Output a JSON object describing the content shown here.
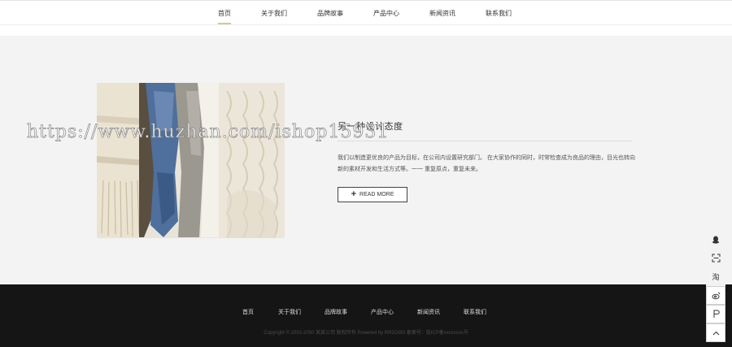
{
  "nav": {
    "items": [
      {
        "label": "首页",
        "active": true
      },
      {
        "label": "关于我们"
      },
      {
        "label": "品牌故事"
      },
      {
        "label": "产品中心"
      },
      {
        "label": "新闻资讯"
      },
      {
        "label": "联系我们"
      }
    ],
    "accent_color": "#d8c79b"
  },
  "feature": {
    "title": "另一种设计态度",
    "description": "我们以制造更优良的产品为目标，在公司内设置研究部门。 在大家协作的同时，时常检查成为良品的理由，目光也转向新的素材开发和生活方式等。一一 重复原点，重复未来。",
    "button_label": "READ MORE",
    "image": "folded-textiles-photo"
  },
  "watermark": "https://www.huzhan.com/ishop15931",
  "footer": {
    "links": [
      "首页",
      "关于我们",
      "品牌故事",
      "产品中心",
      "新闻资讯",
      "联系我们"
    ],
    "copyright": "Copyright © 2002-2050 某某公司 版权所有 Powered by RR2CMS 备案号：桂ICP备xxxxxxxx号"
  },
  "side_tools": [
    "qq-icon",
    "scan-icon",
    "taobao-icon",
    "weibo-icon",
    "tmall-icon",
    "back-to-top-icon"
  ],
  "side_labels": {
    "taobao": "淘"
  }
}
